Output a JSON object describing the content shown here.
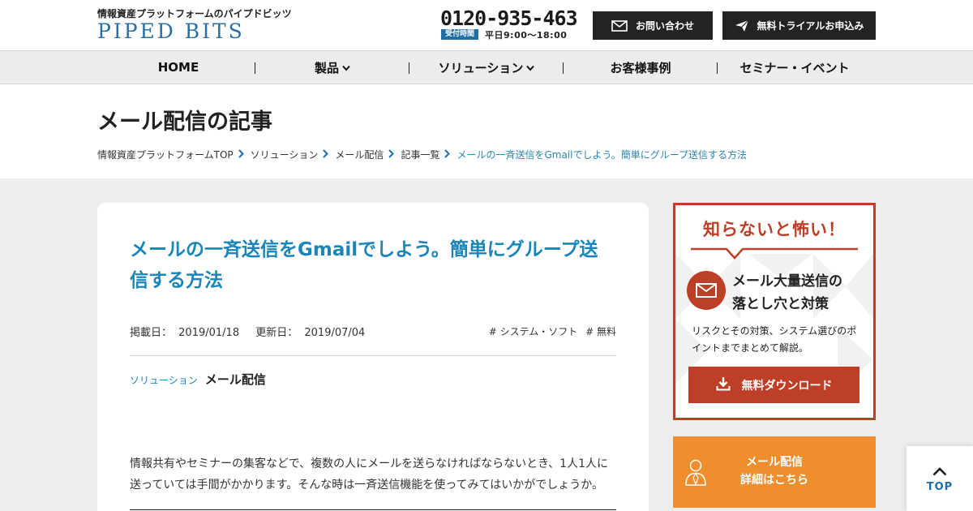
{
  "header": {
    "tagline": "情報資産プラットフォームのパイプドビッツ",
    "logo_text": "PIPED BITS",
    "phone": "0120-935-463",
    "phone_badge": "受付時間",
    "phone_hours": "平日9:00～18:00",
    "contact_label": "お問い合わせ",
    "trial_label": "無料トライアルお申込み"
  },
  "nav": {
    "items": [
      {
        "label": "HOME"
      },
      {
        "label": "製品"
      },
      {
        "label": "ソリューション"
      },
      {
        "label": "お客様事例"
      },
      {
        "label": "セミナー・イベント"
      }
    ]
  },
  "page": {
    "title": "メール配信の記事"
  },
  "breadcrumb": {
    "items": [
      "情報資産プラットフォームTOP",
      "ソリューション",
      "メール配信",
      "記事一覧",
      "メールの一斉送信をGmailでしよう。簡単にグループ送信する方法"
    ]
  },
  "article": {
    "title": "メールの一斉送信をGmailでしよう。簡単にグループ送信する方法",
    "published_label": "掲載日：",
    "published": "2019/01/18",
    "updated_label": "更新日：",
    "updated": "2019/07/04",
    "tags": [
      "# システム・ソフト",
      "# 無料"
    ],
    "category_small": "ソリューション",
    "category_main": "メール配信",
    "intro": "情報共有やセミナーの集客などで、複数の人にメールを送らなければならないとき、1人1人に送っていては手間がかかります。そんな時は一斉送信機能を使ってみてはいかがでしょうか。"
  },
  "ad": {
    "headline": "知らないと怖い！",
    "title_line1": "メール大量送信の",
    "title_line2": "落とし穴と対策",
    "description": "リスクとその対策、システム選びのポイントまでまとめて解説。",
    "button_label": "無料ダウンロード",
    "color": "#bd3f27"
  },
  "banner": {
    "line1": "メール配信",
    "line2": "詳細はこちら",
    "color": "#ee8e2e"
  },
  "top_button": {
    "label": "TOP"
  },
  "colors": {
    "accent_blue": "#1a85b8",
    "header_button": "#232323",
    "background": "#ededed"
  }
}
